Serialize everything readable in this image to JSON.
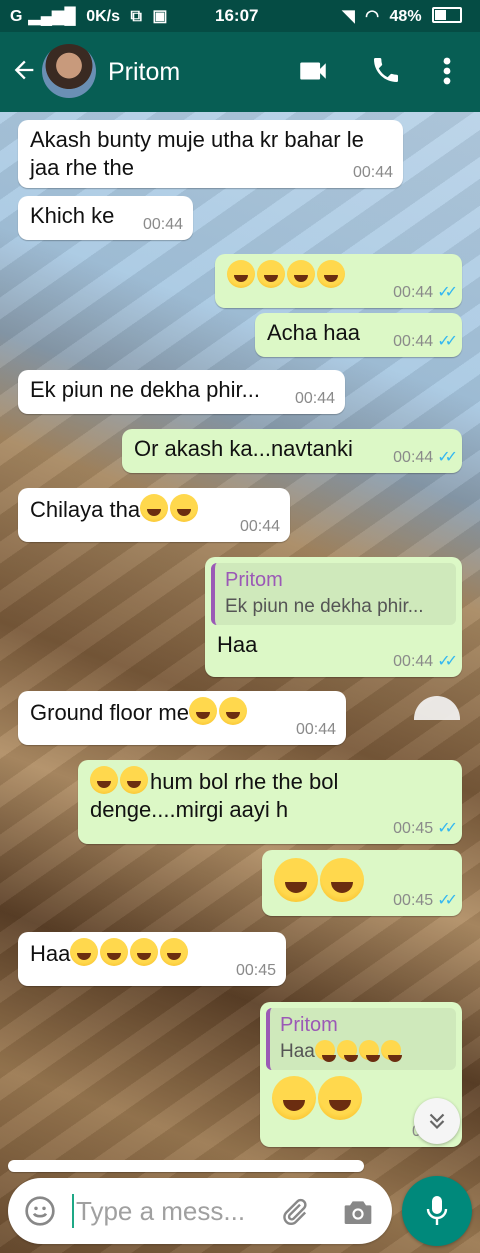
{
  "status_bar": {
    "network": "G",
    "speed": "0K/s",
    "time": "16:07",
    "battery": "48%"
  },
  "header": {
    "contact_name": "Pritom"
  },
  "messages": [
    {
      "text": "Akash bunty muje utha kr bahar le jaa rhe the",
      "time": "00:44"
    },
    {
      "text": "Khich ke",
      "time": "00:44"
    },
    {
      "text": "",
      "time": "00:44"
    },
    {
      "text": "Acha haa",
      "time": "00:44"
    },
    {
      "text": "Ek piun ne dekha phir...",
      "time": "00:44"
    },
    {
      "text": "Or akash ka...navtanki",
      "time": "00:44"
    },
    {
      "text": "Chilaya tha",
      "time": "00:44"
    },
    {
      "quote_name": "Pritom",
      "quote_text": "Ek piun ne dekha phir...",
      "text": "Haa",
      "time": "00:44"
    },
    {
      "text": "Ground floor me",
      "time": "00:44"
    },
    {
      "text": "hum bol rhe the bol denge....mirgi aayi h",
      "time": "00:45"
    },
    {
      "text": "",
      "time": "00:45"
    },
    {
      "text": "Haa",
      "time": "00:45"
    },
    {
      "quote_name": "Pritom",
      "quote_text": "Haa",
      "text": "",
      "time": "00:45"
    }
  ],
  "composer": {
    "placeholder": "Type a mess..."
  }
}
